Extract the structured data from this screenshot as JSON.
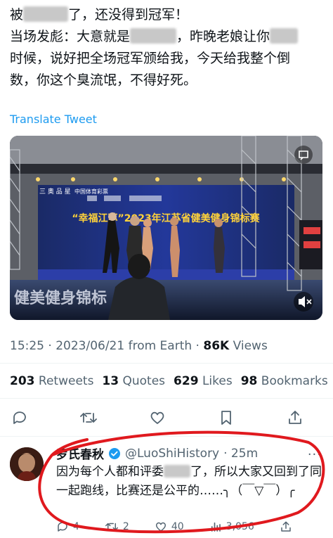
{
  "tweet": {
    "line1a": "被",
    "line1b": "了，还没得到冠军！",
    "line2a": "当场发彪：大意就是",
    "line2b": "，昨晚老娘让你",
    "line3": "时候，说好把全场冠军颁给我，今天给我整个倒",
    "line4": "数，你这个臭流氓，不得好死。",
    "translate_label": "Translate Tweet"
  },
  "media": {
    "banner_text": "“幸福江苏”2023年江苏省健美健身锦标赛",
    "floor_text": "健美健身锦标",
    "sponsor_1": "三 奥 品 星",
    "sponsor_2": "中国体育彩票"
  },
  "meta": {
    "time": "15:25 · 2023/06/21 from Earth · ",
    "views_count": "86K",
    "views_label": " Views"
  },
  "stats": {
    "retweets_count": "203",
    "retweets_label": " Retweets",
    "quotes_count": "13",
    "quotes_label": " Quotes",
    "likes_count": "629",
    "likes_label": " Likes",
    "bookmarks_count": "98",
    "bookmarks_label": " Bookmarks"
  },
  "reply": {
    "name": "罗氏春秋",
    "handle": "@LuoShiHistory",
    "time": "· 25m",
    "text_a": "因为每个人都和评委",
    "text_b": "了，所以大家又回到了同一起跑线，比赛还是公平的……╮（￣▽￣）╭",
    "replies": "4",
    "retweets": "2",
    "likes": "40",
    "views": "3,056"
  },
  "colors": {
    "accent": "#1d9bf0",
    "secondary": "#536471",
    "annotation": "#e0191e"
  }
}
